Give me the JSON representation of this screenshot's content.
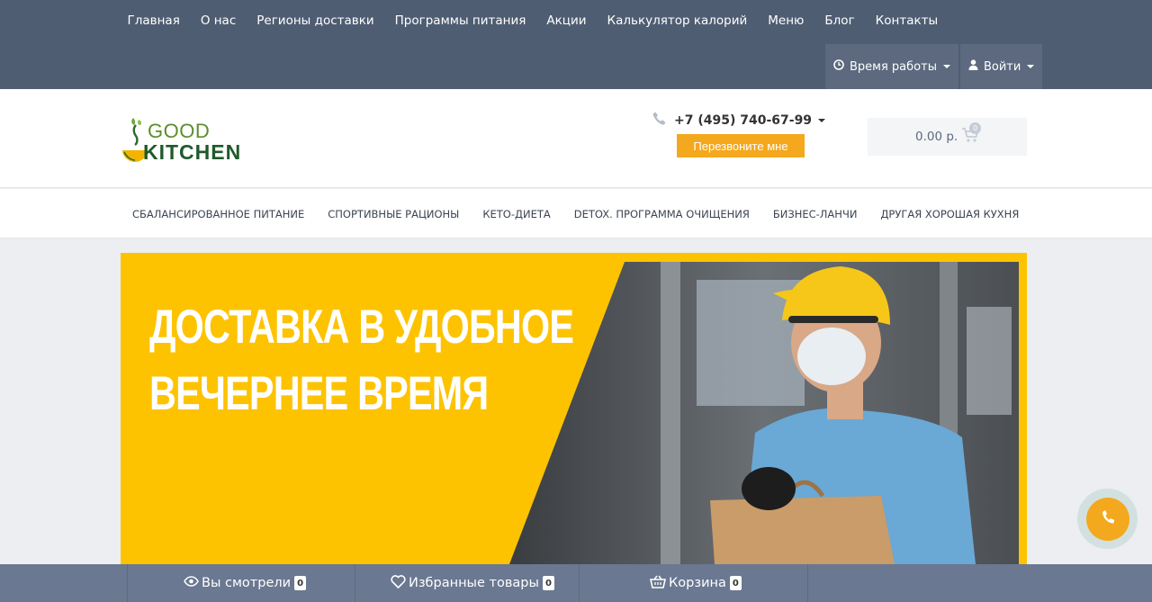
{
  "topnav": [
    "Главная",
    "О нас",
    "Регионы доставки",
    "Программы питания",
    "Акции",
    "Калькулятор калорий",
    "Меню",
    "Блог",
    "Контакты"
  ],
  "topbuttons": {
    "hours": "Время работы",
    "login": "Войти"
  },
  "logo": {
    "good": "GOOD",
    "kitchen": "KITCHEN"
  },
  "header": {
    "phone": "+7 (495) 740-67-99",
    "callback": "Перезвоните мне",
    "cart_amount": "0.00 р.",
    "cart_count": "0"
  },
  "catnav": [
    "Сбалансированное питание",
    "Спортивные рационы",
    "Кето-диета",
    "Detox. Программа очищения",
    "Бизнес-ланчи",
    "Другая хорошая кухня"
  ],
  "banner": {
    "line1": "ДОСТАВКА В УДОБНОЕ",
    "line2": "ВЕЧЕРНЕЕ ВРЕМЯ"
  },
  "bottombar": {
    "viewed": "Вы смотрели",
    "viewed_count": "0",
    "favorites": "Избранные товары",
    "favorites_count": "0",
    "cart": "Корзина",
    "cart_count": "0"
  },
  "colors": {
    "topbar": "#4f5d73",
    "accent": "#f4a81d",
    "banner": "#fdc300",
    "bottombar": "#6a7891"
  }
}
